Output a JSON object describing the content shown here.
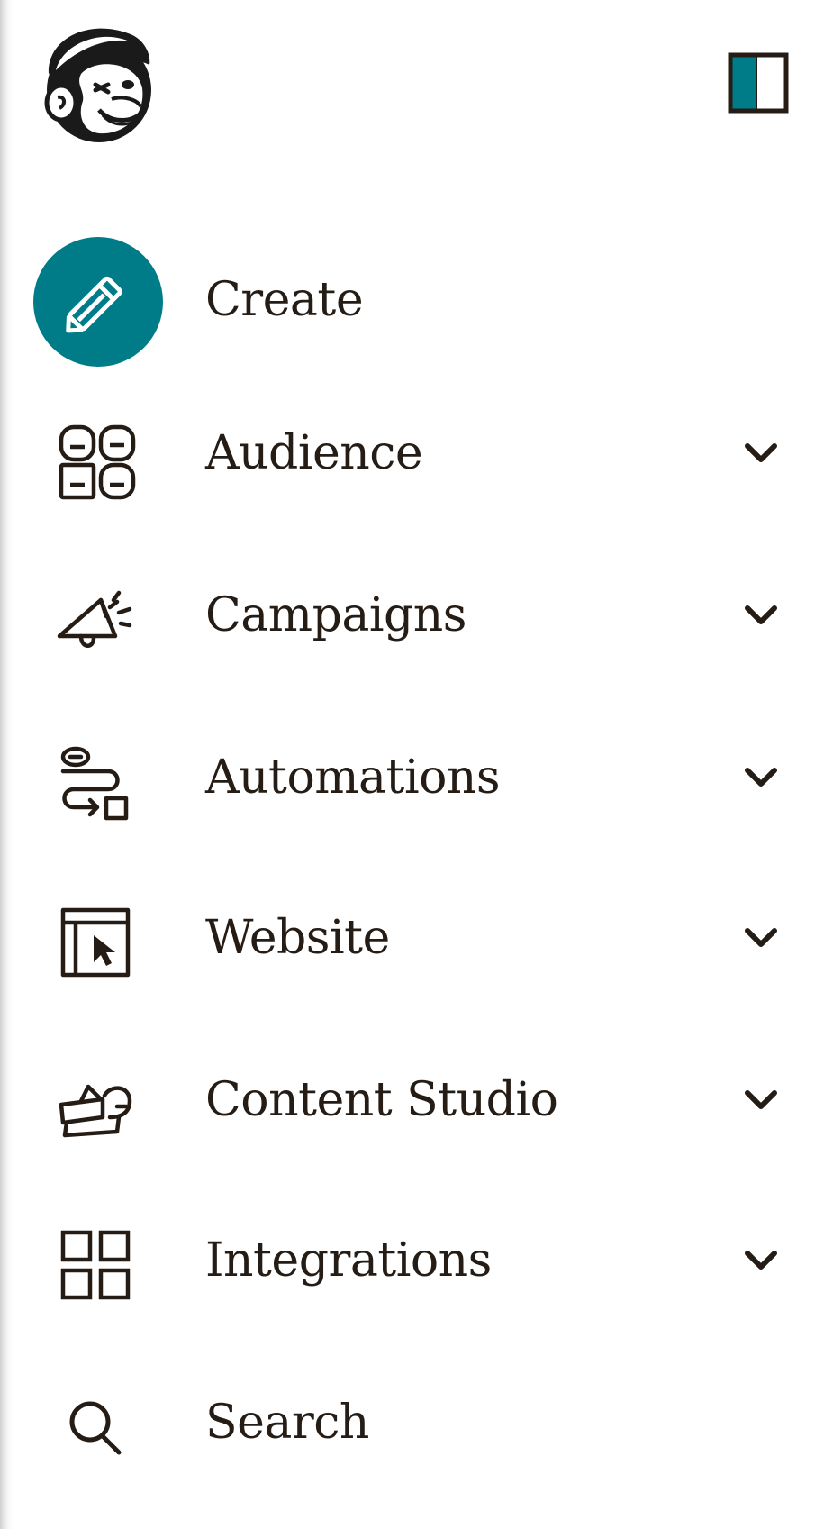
{
  "colors": {
    "accent": "#007c89",
    "text": "#241c15",
    "background": "#ffffff"
  },
  "logo": {
    "icon": "mailchimp-freddie-logo"
  },
  "collapse": {
    "icon": "sidebar-collapse-icon"
  },
  "nav": {
    "items": [
      {
        "label": "Create",
        "icon": "pencil-icon",
        "has_chevron": false
      },
      {
        "label": "Audience",
        "icon": "audience-icon",
        "has_chevron": true
      },
      {
        "label": "Campaigns",
        "icon": "megaphone-icon",
        "has_chevron": true
      },
      {
        "label": "Automations",
        "icon": "automation-flow-icon",
        "has_chevron": true
      },
      {
        "label": "Website",
        "icon": "website-cursor-icon",
        "has_chevron": true
      },
      {
        "label": "Content Studio",
        "icon": "content-studio-icon",
        "has_chevron": true
      },
      {
        "label": "Integrations",
        "icon": "grid-icon",
        "has_chevron": true
      },
      {
        "label": "Search",
        "icon": "search-icon",
        "has_chevron": false
      }
    ]
  }
}
